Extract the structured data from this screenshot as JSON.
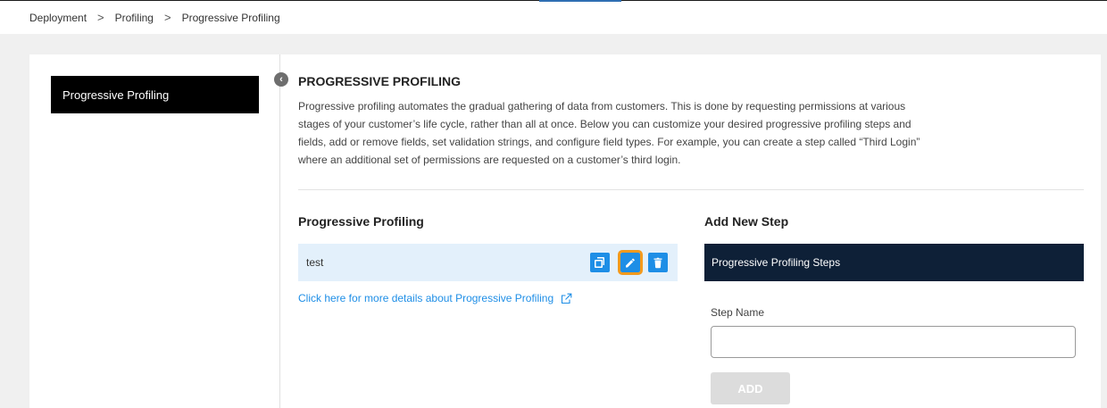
{
  "breadcrumb": {
    "items": [
      "Deployment",
      "Profiling",
      "Progressive Profiling"
    ],
    "separator": ">"
  },
  "sidebar": {
    "items": [
      {
        "label": "Progressive Profiling",
        "active": true
      }
    ],
    "collapse_icon": "chevron-left-icon"
  },
  "main": {
    "title": "PROGRESSIVE PROFILING",
    "description": "Progressive profiling automates the gradual gathering of data from customers. This is done by requesting permissions at various stages of your customer’s life cycle, rather than all at once. Below you can customize your desired progressive profiling steps and fields, add or remove fields, set validation strings, and configure field types. For example, you can create a step called “Third Login” where an additional set of permissions are requested on a customer’s third login.",
    "list_section": {
      "title": "Progressive Profiling",
      "steps": [
        {
          "name": "test",
          "actions": [
            "copy-icon",
            "edit-icon",
            "delete-icon"
          ]
        }
      ],
      "details_link": "Click here for more details about Progressive Profiling",
      "details_link_icon": "external-link-icon"
    },
    "add_section": {
      "title": "Add New Step",
      "header": "Progressive Profiling Steps",
      "step_name_label": "Step Name",
      "step_name_value": "",
      "step_name_placeholder": "",
      "add_button": "ADD"
    }
  },
  "colors": {
    "accent_blue": "#1e8ee6",
    "highlight_orange": "#f39a1e",
    "dark_header": "#0e2037",
    "row_bg": "#e3f0fb"
  }
}
